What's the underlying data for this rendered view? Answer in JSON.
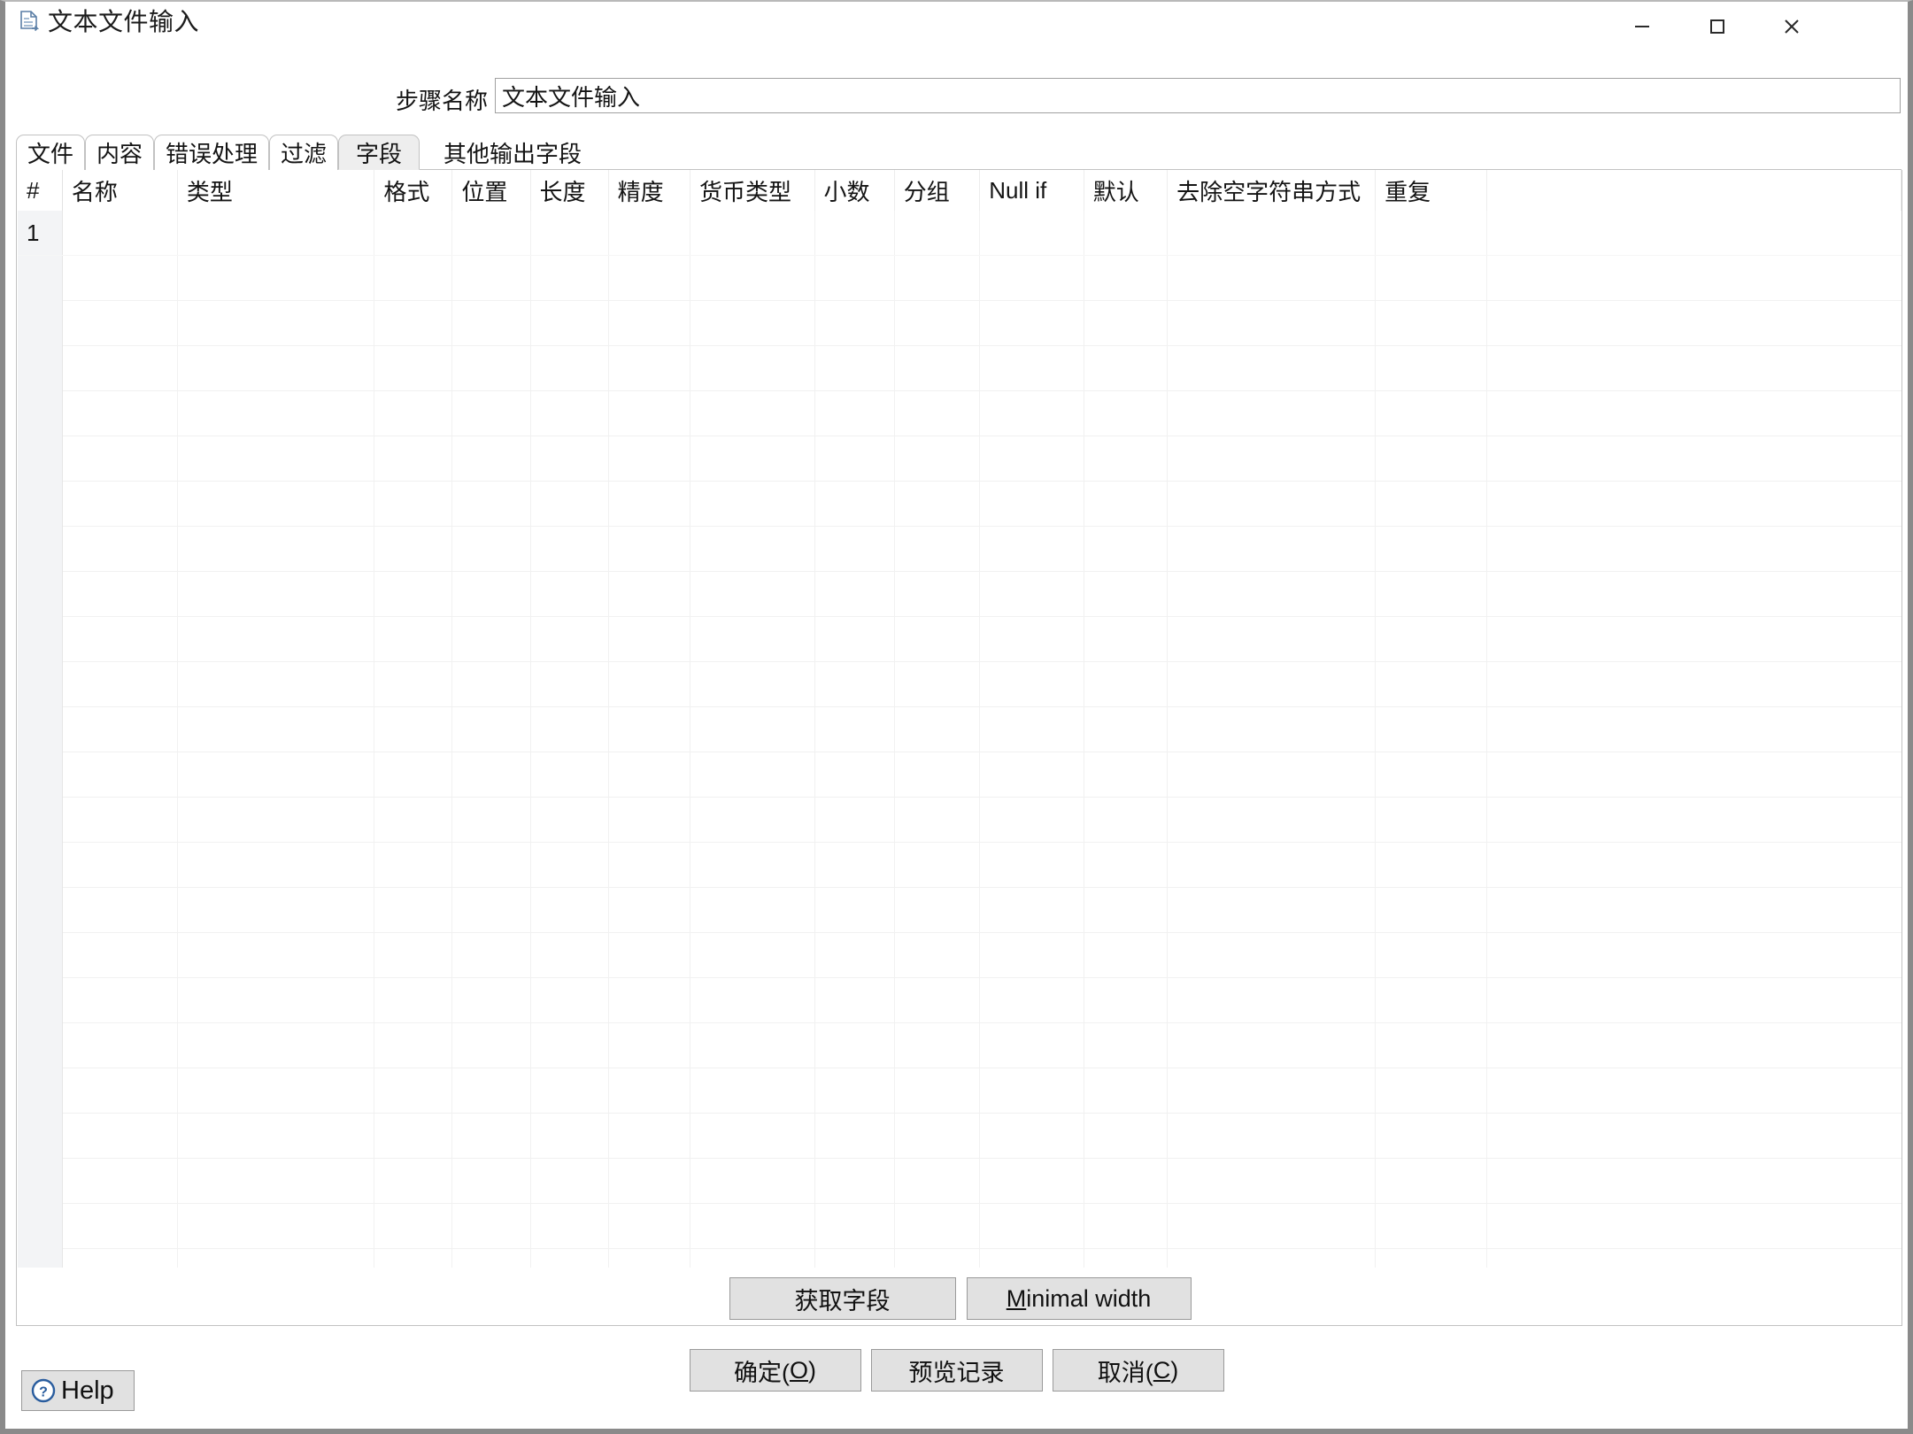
{
  "window": {
    "title": "文本文件输入",
    "icon": "text-file-input-icon",
    "controls": {
      "minimize": "minimize-icon",
      "maximize": "maximize-icon",
      "close": "close-icon"
    }
  },
  "step": {
    "label": "步骤名称",
    "value": "文本文件输入",
    "placeholder": ""
  },
  "tabs": [
    {
      "label": "文件",
      "selected": false
    },
    {
      "label": "内容",
      "selected": false
    },
    {
      "label": "错误处理",
      "selected": false
    },
    {
      "label": "过滤",
      "selected": false
    },
    {
      "label": "字段",
      "selected": true
    },
    {
      "label": "其他输出字段",
      "selected": false
    }
  ],
  "table": {
    "columns": [
      "#",
      "名称",
      "类型",
      "格式",
      "位置",
      "长度",
      "精度",
      "货币类型",
      "小数",
      "分组",
      "Null if",
      "默认",
      "去除空字符串方式",
      "重复"
    ],
    "rows": [
      {
        "num": "1",
        "cells": [
          "",
          "",
          "",
          "",
          "",
          "",
          "",
          "",
          "",
          "",
          "",
          "",
          ""
        ]
      }
    ],
    "empty_row_count": 24
  },
  "mid_buttons": {
    "get_fields": "获取字段",
    "minimal_width_mnemonic": "M",
    "minimal_width_rest": "inimal width"
  },
  "footer": {
    "ok_text": "确定(",
    "ok_mnemonic": "O",
    "ok_tail": ")",
    "preview": "预览记录",
    "cancel_text": "取消(",
    "cancel_mnemonic": "C",
    "cancel_tail": ")",
    "help": "Help"
  },
  "colors": {
    "window_border": "#8a8a8a",
    "tab_selected_bg": "#eeeeee",
    "button_bg": "#e1e1e1",
    "rownum_bg": "#f3f4f6",
    "grid_line": "#f1f1f1",
    "help_icon": "#2a5d9e"
  }
}
